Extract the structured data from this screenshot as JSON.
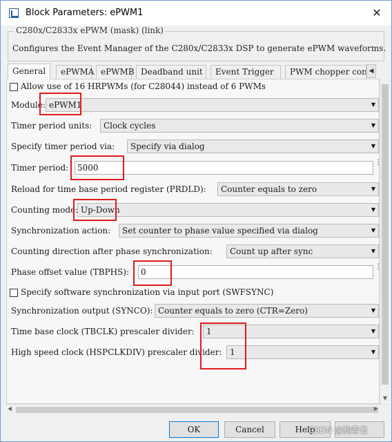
{
  "window": {
    "title": "Block Parameters: ePWM1",
    "close_glyph": "✕",
    "accent_color": "#6f9bd1"
  },
  "header": {
    "legend": "C280x/C2833x ePWM (mask) (link)",
    "description": "Configures the Event Manager of the C280x/C2833x DSP to generate ePWM waveforms."
  },
  "tabs": [
    {
      "label": "General",
      "active": true
    },
    {
      "label": "ePWMA"
    },
    {
      "label": "ePWMB"
    },
    {
      "label": "Deadband unit"
    },
    {
      "label": "Event Trigger"
    },
    {
      "label": "PWM chopper contr"
    }
  ],
  "tab_scroll_glyph": "◀",
  "general": {
    "hrpwm_checkbox_label": "Allow use of 16 HRPWMs (for C28044) instead of 6 PWMs",
    "module_label": "Module:",
    "module_value": "ePWM1",
    "timer_units_label": "Timer period units:",
    "timer_units_value": "Clock cycles",
    "specify_via_label": "Specify timer period via:",
    "specify_via_value": "Specify via dialog",
    "timer_period_label": "Timer period:",
    "timer_period_value": "5000",
    "reload_label": "Reload for time base period register (PRDLD):",
    "reload_value": "Counter equals to zero",
    "counting_mode_label": "Counting mode:",
    "counting_mode_value": "Up-Down",
    "sync_action_label": "Synchronization action:",
    "sync_action_value": "Set counter to phase value specified via dialog",
    "count_dir_label": "Counting direction after phase synchronization:",
    "count_dir_value": "Count up after sync",
    "phase_offset_label": "Phase offset value (TBPHS):",
    "phase_offset_value": "0",
    "sw_sync_label": "Specify software synchronization via input port (SWFSYNC)",
    "sync_output_label": "Synchronization output (SYNCO):",
    "sync_output_value": "Counter equals to zero (CTR=Zero)",
    "tbclk_label": "Time base clock (TBCLK) prescaler divider:",
    "tbclk_value": "1",
    "hspclk_label": "High speed clock (HSPCLKDIV) prescaler divider:",
    "hspclk_value": "1"
  },
  "caret_glyph": "▼",
  "highlight_color": "#e0191a",
  "buttons": {
    "ok": "OK",
    "cancel": "Cancel",
    "help": "Help"
  },
  "watermark": "CSDN @狗青云"
}
